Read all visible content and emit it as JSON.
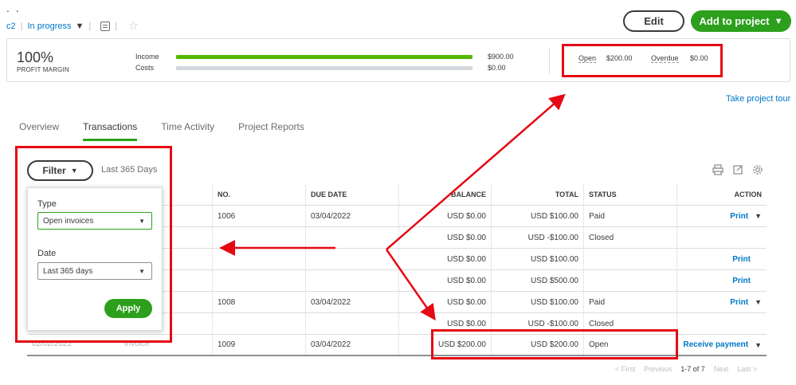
{
  "header": {
    "dots": ". .",
    "project_code": "c2",
    "status": "In progress",
    "edit_label": "Edit",
    "add_label": "Add to project"
  },
  "summary": {
    "profit_margin_value": "100%",
    "profit_margin_label": "PROFIT MARGIN",
    "income_label": "Income",
    "costs_label": "Costs",
    "income_amount": "$900.00",
    "costs_amount": "$0.00",
    "income_fill": 1.0,
    "costs_fill": 0.0,
    "open_label": "Open",
    "open_value": "$200.00",
    "overdue_label": "Overdue",
    "overdue_value": "$0.00"
  },
  "tour_link": "Take project tour",
  "tabs": [
    {
      "label": "Overview",
      "active": false
    },
    {
      "label": "Transactions",
      "active": true
    },
    {
      "label": "Time Activity",
      "active": false
    },
    {
      "label": "Project Reports",
      "active": false
    }
  ],
  "filter": {
    "button_label": "Filter",
    "range_text": "Last 365 Days",
    "type_label": "Type",
    "type_value": "Open invoices",
    "date_label": "Date",
    "date_value": "Last 365 days",
    "apply_label": "Apply"
  },
  "table": {
    "headers": {
      "no": "NO.",
      "due_date": "DUE DATE",
      "balance": "BALANCE",
      "total": "TOTAL",
      "status": "STATUS",
      "action": "ACTION"
    },
    "rows": [
      {
        "no": "1006",
        "due": "03/04/2022",
        "balance": "USD $0.00",
        "total": "USD $100.00",
        "status": "Paid",
        "action": "Print",
        "caret": true
      },
      {
        "no": "",
        "due": "",
        "balance": "USD $0.00",
        "total": "USD -$100.00",
        "status": "Closed",
        "action": "",
        "caret": false
      },
      {
        "no": "",
        "due": "",
        "balance": "USD $0.00",
        "total": "USD $100.00",
        "status": "",
        "action": "Print",
        "caret": false
      },
      {
        "no": "",
        "due": "",
        "balance": "USD $0.00",
        "total": "USD $500.00",
        "status": "",
        "action": "Print",
        "caret": false
      },
      {
        "no": "1008",
        "due": "03/04/2022",
        "balance": "USD $0.00",
        "total": "USD $100.00",
        "status": "Paid",
        "action": "Print",
        "caret": true
      },
      {
        "no": "",
        "due": "",
        "balance": "USD $0.00",
        "total": "USD -$100.00",
        "status": "Closed",
        "action": "",
        "caret": false
      },
      {
        "no": "1009",
        "due": "03/04/2022",
        "balance": "USD $200.00",
        "total": "USD $200.00",
        "status": "Open",
        "action": "Receive payment",
        "caret": true
      }
    ],
    "obscured_last_row": {
      "date": "02/02/2022",
      "type": "Invoice"
    }
  },
  "pager": {
    "first": "< First",
    "previous": "Previous",
    "range": "1-7 of 7",
    "next": "Next",
    "last": "Last >"
  },
  "colors": {
    "brand_green": "#2ca01c",
    "income_bar": "#53b700",
    "link_blue": "#0077c5",
    "annotation_red": "#e50914"
  }
}
